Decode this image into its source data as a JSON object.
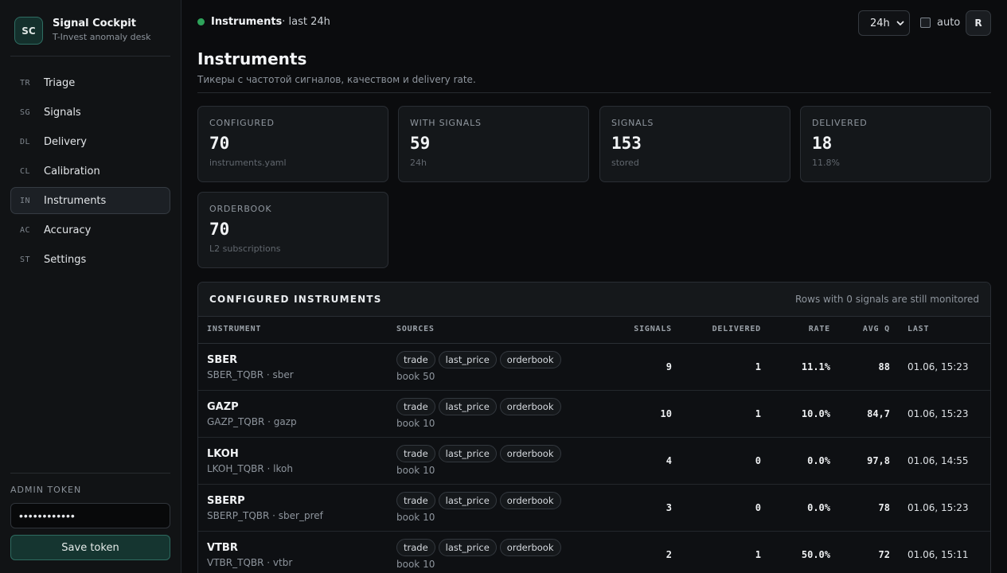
{
  "brand": {
    "logo": "SC",
    "title": "Signal Cockpit",
    "subtitle": "T-Invest anomaly desk"
  },
  "nav": [
    {
      "code": "TR",
      "label": "Triage"
    },
    {
      "code": "SG",
      "label": "Signals"
    },
    {
      "code": "DL",
      "label": "Delivery"
    },
    {
      "code": "CL",
      "label": "Calibration"
    },
    {
      "code": "IN",
      "label": "Instruments",
      "active": true
    },
    {
      "code": "AC",
      "label": "Accuracy"
    },
    {
      "code": "ST",
      "label": "Settings"
    }
  ],
  "token": {
    "label": "ADMIN TOKEN",
    "value": "••••••••••••",
    "save_label": "Save token"
  },
  "topbar": {
    "status_bold": "Instruments",
    "status_rest": " · last 24h",
    "status_color": "#2ea35a",
    "range": "24h",
    "auto_label": "auto",
    "auto_checked": false,
    "refresh_label": "R"
  },
  "page": {
    "title": "Instruments",
    "subtitle": "Тикеры с частотой сигналов, качеством и delivery rate."
  },
  "cards": [
    {
      "label": "CONFIGURED",
      "value": "70",
      "note": "instruments.yaml"
    },
    {
      "label": "WITH SIGNALS",
      "value": "59",
      "note": "24h"
    },
    {
      "label": "SIGNALS",
      "value": "153",
      "note": "stored"
    },
    {
      "label": "DELIVERED",
      "value": "18",
      "note": "11.8%"
    },
    {
      "label": "ORDERBOOK",
      "value": "70",
      "note": "L2 subscriptions"
    }
  ],
  "table": {
    "title": "CONFIGURED INSTRUMENTS",
    "note": "Rows with 0 signals are still monitored",
    "columns": {
      "instrument": "INSTRUMENT",
      "sources": "SOURCES",
      "signals": "SIGNALS",
      "delivered": "DELIVERED",
      "rate": "RATE",
      "avg_q": "AVG Q",
      "last": "LAST"
    },
    "rows": [
      {
        "symbol": "SBER",
        "sub": "SBER_TQBR · sber",
        "tags": [
          "trade",
          "last_price",
          "orderbook"
        ],
        "book": "book 50",
        "signals": "9",
        "delivered": "1",
        "rate": "11.1%",
        "avg_q": "88",
        "last": "01.06, 15:23"
      },
      {
        "symbol": "GAZP",
        "sub": "GAZP_TQBR · gazp",
        "tags": [
          "trade",
          "last_price",
          "orderbook"
        ],
        "book": "book 10",
        "signals": "10",
        "delivered": "1",
        "rate": "10.0%",
        "avg_q": "84,7",
        "last": "01.06, 15:23"
      },
      {
        "symbol": "LKOH",
        "sub": "LKOH_TQBR · lkoh",
        "tags": [
          "trade",
          "last_price",
          "orderbook"
        ],
        "book": "book 10",
        "signals": "4",
        "delivered": "0",
        "rate": "0.0%",
        "avg_q": "97,8",
        "last": "01.06, 14:55"
      },
      {
        "symbol": "SBERP",
        "sub": "SBERP_TQBR · sber_pref",
        "tags": [
          "trade",
          "last_price",
          "orderbook"
        ],
        "book": "book 10",
        "signals": "3",
        "delivered": "0",
        "rate": "0.0%",
        "avg_q": "78",
        "last": "01.06, 15:23"
      },
      {
        "symbol": "VTBR",
        "sub": "VTBR_TQBR · vtbr",
        "tags": [
          "trade",
          "last_price",
          "orderbook"
        ],
        "book": "book 10",
        "signals": "2",
        "delivered": "1",
        "rate": "50.0%",
        "avg_q": "72",
        "last": "01.06, 15:11"
      }
    ]
  }
}
